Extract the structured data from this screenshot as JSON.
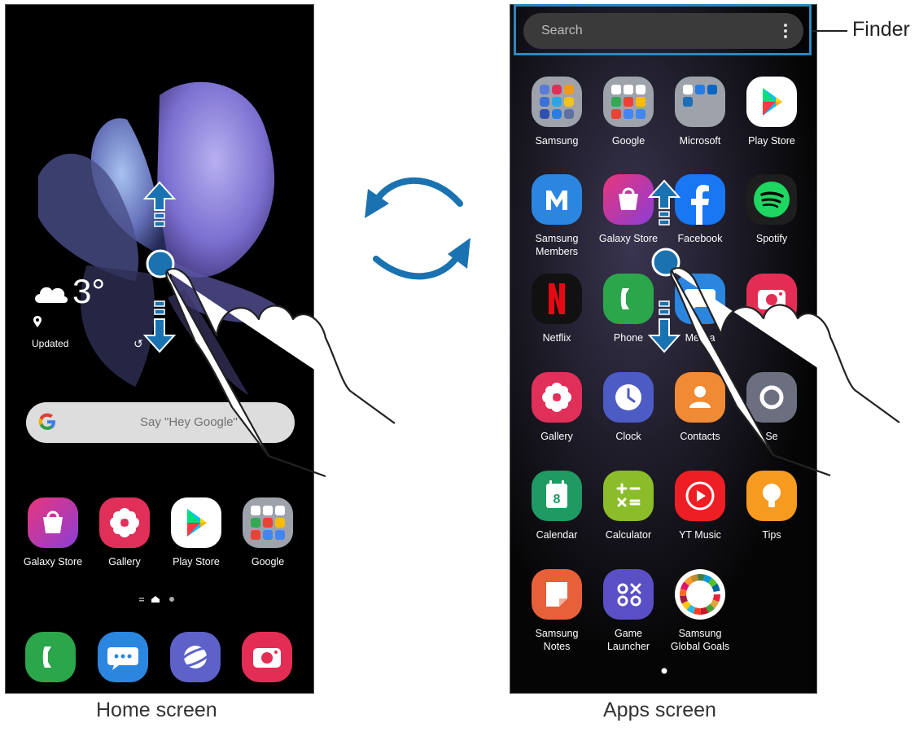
{
  "home": {
    "caption": "Home screen",
    "weather_temp": "3°",
    "weather_updated": "Updated",
    "google_hint": "Say \"Hey Google\"",
    "apps": [
      {
        "label": "Galaxy Store",
        "icon": "galaxy-store-icon"
      },
      {
        "label": "Gallery",
        "icon": "gallery-icon"
      },
      {
        "label": "Play Store",
        "icon": "play-store-icon"
      },
      {
        "label": "Google",
        "icon": "google-folder-icon"
      }
    ],
    "dock": [
      "phone-icon",
      "messages-icon",
      "internet-icon",
      "camera-icon"
    ]
  },
  "apps_screen": {
    "caption": "Apps screen",
    "search_placeholder": "Search",
    "finder_label": "Finder",
    "apps": [
      {
        "label": "Samsung",
        "icon": "samsung-folder-icon"
      },
      {
        "label": "Google",
        "icon": "google-folder-icon"
      },
      {
        "label": "Microsoft",
        "icon": "microsoft-folder-icon"
      },
      {
        "label": "Play Store",
        "icon": "play-store-icon"
      },
      {
        "label": "Samsung\nMembers",
        "icon": "samsung-members-icon"
      },
      {
        "label": "Galaxy Store",
        "icon": "galaxy-store-icon"
      },
      {
        "label": "Facebook",
        "icon": "facebook-icon"
      },
      {
        "label": "Spotify",
        "icon": "spotify-icon"
      },
      {
        "label": "Netflix",
        "icon": "netflix-icon"
      },
      {
        "label": "Phone",
        "icon": "phone-icon"
      },
      {
        "label": "Messa",
        "icon": "messages-icon"
      },
      {
        "label": "",
        "icon": "camera-icon"
      },
      {
        "label": "Gallery",
        "icon": "gallery-icon"
      },
      {
        "label": "Clock",
        "icon": "clock-icon"
      },
      {
        "label": "Contacts",
        "icon": "contacts-icon"
      },
      {
        "label": "Se",
        "icon": "settings-icon"
      },
      {
        "label": "Calendar",
        "icon": "calendar-icon"
      },
      {
        "label": "Calculator",
        "icon": "calculator-icon"
      },
      {
        "label": "YT Music",
        "icon": "yt-music-icon"
      },
      {
        "label": "Tips",
        "icon": "tips-icon"
      },
      {
        "label": "Samsung\nNotes",
        "icon": "samsung-notes-icon"
      },
      {
        "label": "Game\nLauncher",
        "icon": "game-launcher-icon"
      },
      {
        "label": "Samsung\nGlobal Goals",
        "icon": "global-goals-icon"
      }
    ]
  },
  "colors": {
    "accent": "#1a73b0",
    "finder_box": "#2e86c1"
  }
}
